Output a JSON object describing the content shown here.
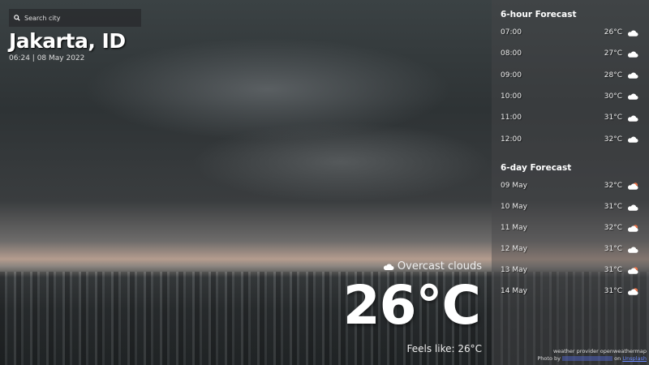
{
  "search": {
    "placeholder": "Search city"
  },
  "location": {
    "name": "Jakarta, ID",
    "datetime": "06:24 | 08 May 2022"
  },
  "current": {
    "description": "Overcast clouds",
    "temperature": "26°C",
    "feels_like": "Feels like: 26°C",
    "icon": "cloud-icon"
  },
  "hourly": {
    "title": "6-hour Forecast",
    "items": [
      {
        "time": "07:00",
        "temp": "26°C",
        "icon": "cloud"
      },
      {
        "time": "08:00",
        "temp": "27°C",
        "icon": "cloud"
      },
      {
        "time": "09:00",
        "temp": "28°C",
        "icon": "cloud"
      },
      {
        "time": "10:00",
        "temp": "30°C",
        "icon": "cloud"
      },
      {
        "time": "11:00",
        "temp": "31°C",
        "icon": "cloud"
      },
      {
        "time": "12:00",
        "temp": "32°C",
        "icon": "cloud"
      }
    ]
  },
  "daily": {
    "title": "6-day Forecast",
    "items": [
      {
        "date": "09 May",
        "temp": "32°C",
        "icon": "sun-cloud"
      },
      {
        "date": "10 May",
        "temp": "31°C",
        "icon": "cloud"
      },
      {
        "date": "11 May",
        "temp": "32°C",
        "icon": "sun-cloud"
      },
      {
        "date": "12 May",
        "temp": "31°C",
        "icon": "cloud"
      },
      {
        "date": "13 May",
        "temp": "31°C",
        "icon": "sun-cloud"
      },
      {
        "date": "14 May",
        "temp": "31°C",
        "icon": "sun-cloud"
      }
    ]
  },
  "credits": {
    "provider": "weather provider openweathermap",
    "photo_prefix": "Photo by",
    "photo_on": "on",
    "unsplash": "Unsplash"
  },
  "colors": {
    "link": "#6c8bff",
    "sun": "#e8734a"
  }
}
